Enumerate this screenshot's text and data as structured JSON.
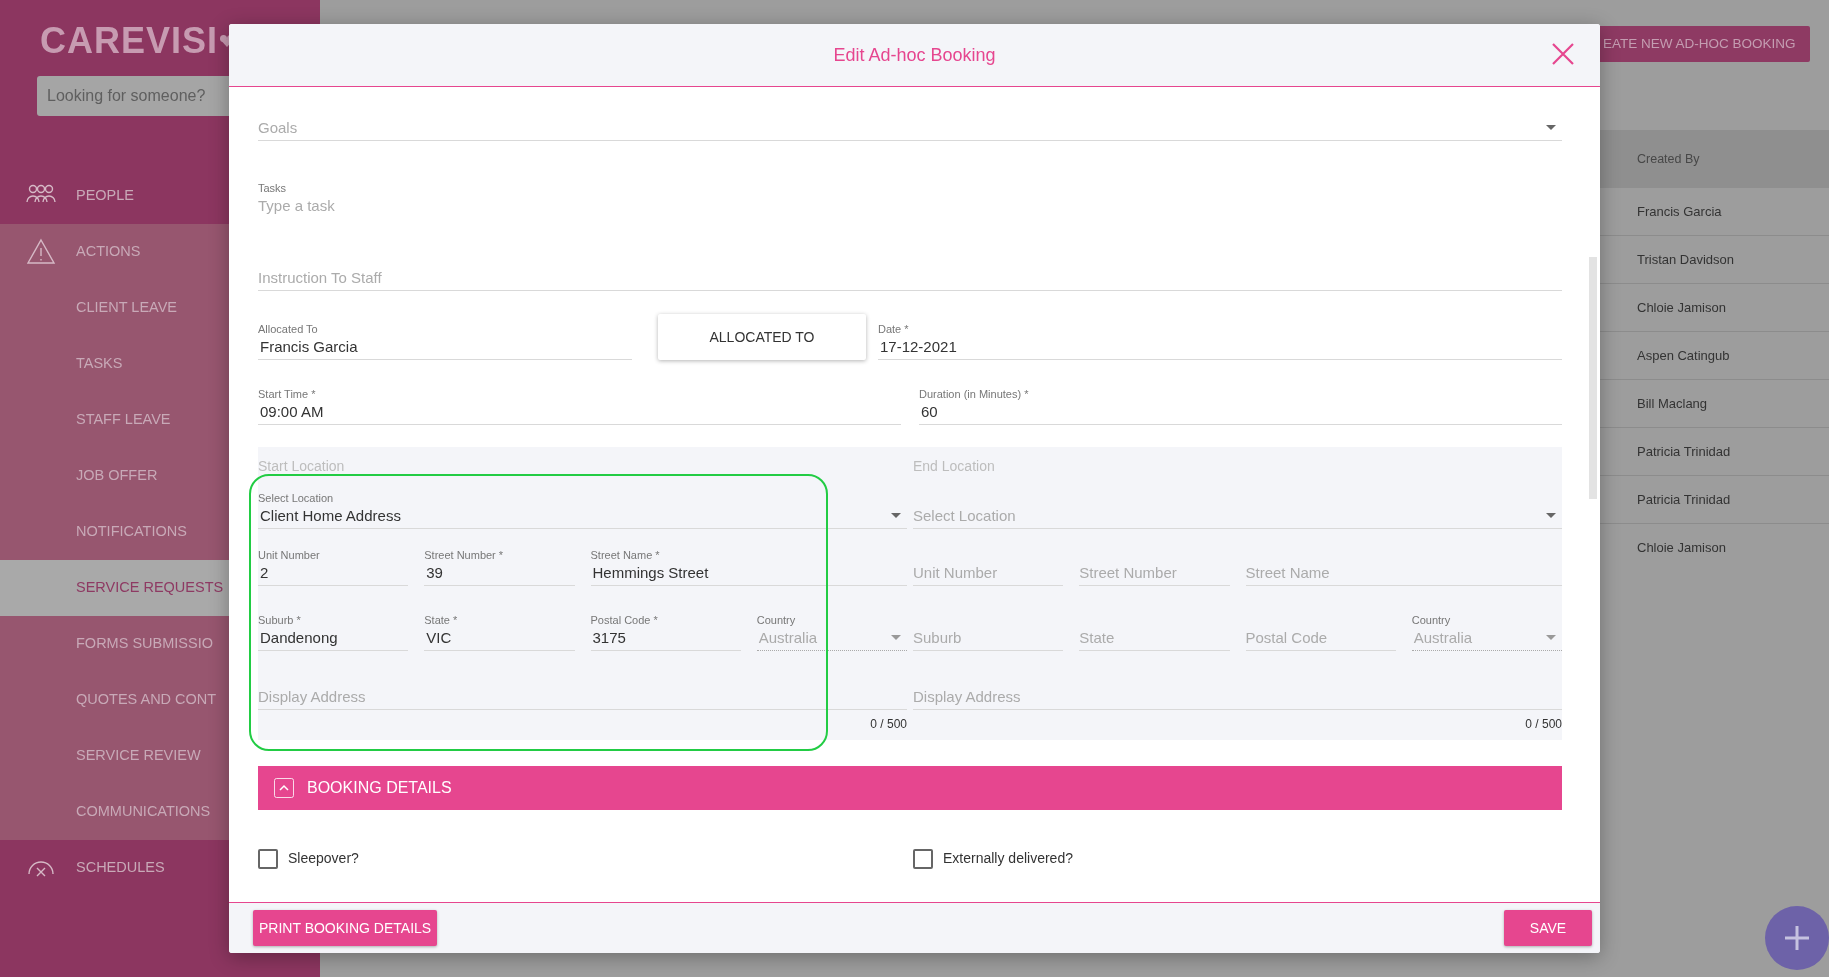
{
  "sidebar": {
    "logo": "CAREVISI",
    "search": {
      "placeholder": "Looking for someone?"
    },
    "items": [
      {
        "label": "PEOPLE",
        "selected": false
      },
      {
        "label": "ACTIONS",
        "selected": false,
        "expanded": true,
        "children": [
          {
            "label": "CLIENT LEAVE",
            "selected": false
          },
          {
            "label": "TASKS",
            "selected": false
          },
          {
            "label": "STAFF LEAVE",
            "selected": false
          },
          {
            "label": "JOB OFFER",
            "selected": false
          },
          {
            "label": "NOTIFICATIONS",
            "selected": false
          },
          {
            "label": "SERVICE REQUESTS",
            "selected": true
          },
          {
            "label": "FORMS SUBMISSIO",
            "selected": false
          },
          {
            "label": "QUOTES AND CONT",
            "selected": false
          },
          {
            "label": "SERVICE REVIEW",
            "selected": false
          },
          {
            "label": "COMMUNICATIONS",
            "selected": false
          }
        ]
      },
      {
        "label": "SCHEDULES",
        "selected": false
      }
    ]
  },
  "main": {
    "create_button": "EATE NEW AD-HOC BOOKING",
    "table": {
      "columns": [
        "Created By"
      ],
      "rows": [
        [
          "Francis Garcia"
        ],
        [
          "Tristan Davidson"
        ],
        [
          "Chloie Jamison"
        ],
        [
          "Aspen Catingub"
        ],
        [
          "Bill Maclang"
        ],
        [
          "Patricia Trinidad"
        ],
        [
          "Patricia Trinidad"
        ],
        [
          "Chloie Jamison"
        ]
      ]
    }
  },
  "modal": {
    "title": "Edit Ad-hoc Booking",
    "goals": {
      "placeholder": "Goals"
    },
    "tasks": {
      "label": "Tasks",
      "placeholder": "Type a task"
    },
    "instruction": {
      "placeholder": "Instruction To Staff"
    },
    "allocated_to": {
      "label": "Allocated To",
      "value": "Francis Garcia"
    },
    "allocate_button": "ALLOCATED TO",
    "date": {
      "label": "Date *",
      "value": "17-12-2021"
    },
    "start_time": {
      "label": "Start Time *",
      "value": "09:00 AM"
    },
    "duration": {
      "label": "Duration (in Minutes) *",
      "value": "60"
    },
    "locations": [
      {
        "title": "Start Location",
        "highlighted": true,
        "select": {
          "label": "Select Location",
          "value": "Client Home Address"
        },
        "rows": [
          [
            {
              "label": "Unit Number",
              "value": "2"
            },
            {
              "label": "Street Number *",
              "value": "39"
            },
            {
              "label": "Street Name *",
              "value": "Hemmings Street"
            }
          ],
          [
            {
              "label": "Suburb *",
              "value": "Dandenong"
            },
            {
              "label": "State *",
              "value": "VIC"
            },
            {
              "label": "Postal Code *",
              "value": "3175"
            },
            {
              "label": "Country",
              "value": "Australia",
              "kind": "select",
              "disabled": true
            }
          ]
        ],
        "display_address": {
          "placeholder": "Display Address",
          "counter": "0 / 500"
        }
      },
      {
        "title": "End Location",
        "highlighted": false,
        "select": {
          "placeholder": "Select Location"
        },
        "rows": [
          [
            {
              "placeholder": "Unit Number"
            },
            {
              "placeholder": "Street Number"
            },
            {
              "placeholder": "Street Name"
            }
          ],
          [
            {
              "placeholder": "Suburb"
            },
            {
              "placeholder": "State"
            },
            {
              "placeholder": "Postal Code"
            },
            {
              "label": "Country",
              "value": "Australia",
              "kind": "select",
              "disabled": true
            }
          ]
        ],
        "display_address": {
          "placeholder": "Display Address",
          "counter": "0 / 500"
        }
      }
    ],
    "booking_details": {
      "title": "BOOKING DETAILS",
      "expanded": true,
      "checkboxes": [
        {
          "label": "Sleepover?",
          "checked": false
        },
        {
          "label": "Externally delivered?",
          "checked": false
        }
      ]
    },
    "footer": {
      "print_button": "PRINT BOOKING DETAILS",
      "save_button": "SAVE"
    }
  }
}
